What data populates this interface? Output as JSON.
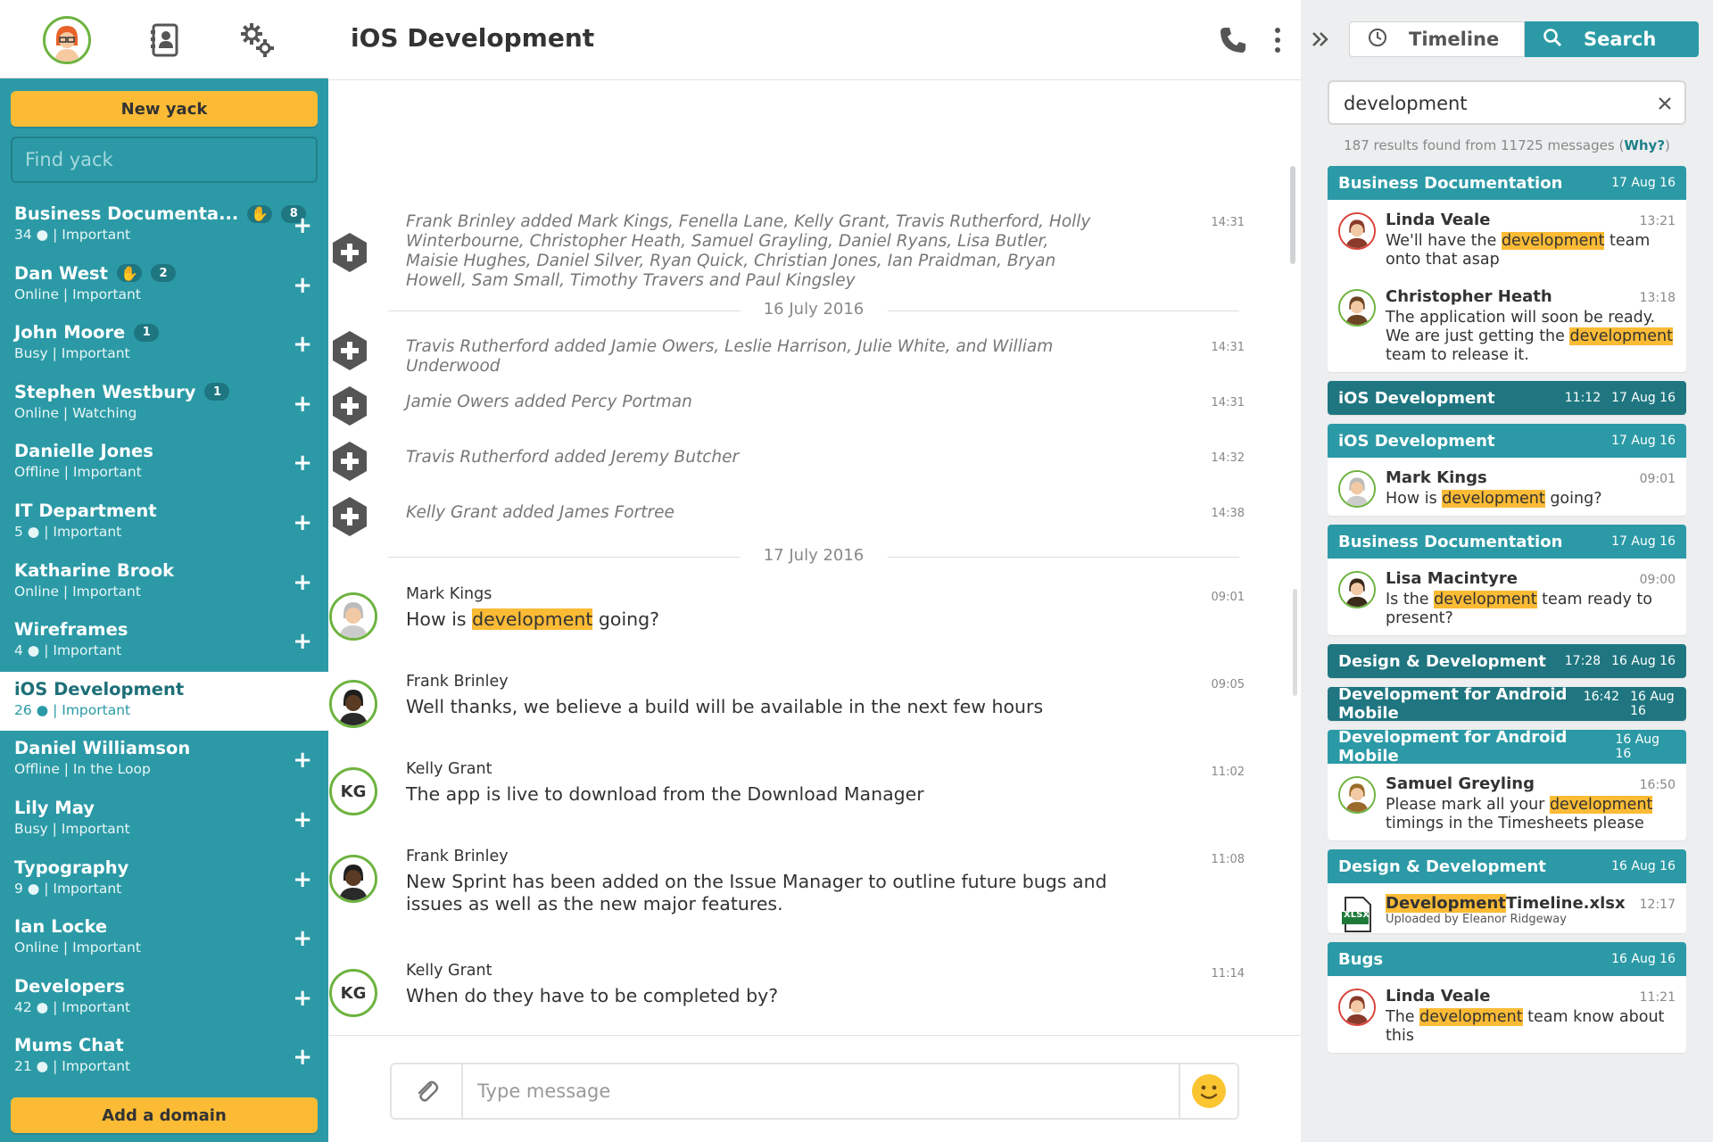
{
  "sidebar": {
    "new_yack_label": "New yack",
    "find_placeholder": "Find yack",
    "add_domain_label": "Add a domain",
    "chats": [
      {
        "name": "Business Documenta...",
        "sub": "34 ● | Important",
        "count": "8",
        "thumb": true
      },
      {
        "name": "Dan West",
        "sub": "Online | Important",
        "count": "2",
        "thumb": true
      },
      {
        "name": "John Moore",
        "sub": "Busy | Important",
        "count": "1"
      },
      {
        "name": "Stephen Westbury",
        "sub": "Online | Watching",
        "count": "1"
      },
      {
        "name": "Danielle Jones",
        "sub": "Offline | Important"
      },
      {
        "name": "IT Department",
        "sub": "5 ● | Important"
      },
      {
        "name": "Katharine Brook",
        "sub": "Online | Important"
      },
      {
        "name": "Wireframes",
        "sub": "4 ● | Important"
      },
      {
        "name": "iOS Development",
        "sub": "26 ● | Important",
        "active": true
      },
      {
        "name": "Daniel Williamson",
        "sub": "Offline | In the Loop"
      },
      {
        "name": "Lily May",
        "sub": "Busy | Important"
      },
      {
        "name": "Typography",
        "sub": "9 ● | Important"
      },
      {
        "name": "Ian Locke",
        "sub": "Online | Important"
      },
      {
        "name": "Developers",
        "sub": "42 ● | Important"
      },
      {
        "name": "Mums Chat",
        "sub": "21 ● | Important"
      }
    ]
  },
  "main": {
    "title": "iOS Development",
    "system_messages": [
      {
        "text": "Frank Brinley added Mark Kings, Fenella Lane, Kelly Grant, Travis Rutherford, Holly Winterbourne, Christopher Heath, Samuel Grayling, Daniel Ryans, Lisa Butler, Maisie Hughes, Daniel Silver, Ryan Quick, Christian Jones, Ian Praidman, Bryan Howell, Sam Small, Timothy Travers and Paul Kingsley",
        "time": "14:31"
      },
      {
        "text": "Travis Rutherford added Jamie Owers, Leslie Harrison, Julie White, and William Underwood",
        "time": "14:31"
      },
      {
        "text": "Jamie Owers added Percy Portman",
        "time": "14:31"
      },
      {
        "text": "Travis Rutherford added Jeremy Butcher",
        "time": "14:32"
      },
      {
        "text": "Kelly Grant added James Fortree",
        "time": "14:38"
      }
    ],
    "date_1": "16 July 2016",
    "date_2": "17 July 2016",
    "messages": [
      {
        "author": "Mark Kings",
        "pre": "How is ",
        "hl": "development",
        "post": " going?",
        "time": "09:01"
      },
      {
        "author": "Frank Brinley",
        "text": "Well thanks, we believe a build will be available in the next few hours",
        "time": "09:05"
      },
      {
        "author": "Kelly Grant",
        "initials": "KG",
        "text": "The app is live to download from the Download Manager",
        "time": "11:02"
      },
      {
        "author": "Frank Brinley",
        "text": "New Sprint has been added on the Issue Manager to outline future bugs and issues as well as the new major features.",
        "time": "11:08"
      },
      {
        "author": "Kelly Grant",
        "initials": "KG",
        "text": "When do they have to be completed by?",
        "time": "11:14"
      }
    ],
    "composer_placeholder": "Type message"
  },
  "right": {
    "tab_timeline": "Timeline",
    "tab_search": "Search",
    "search_value": "development",
    "summary_prefix": "187 results found from 11725 messages (",
    "summary_why": "Why?",
    "summary_suffix": ")",
    "results": [
      {
        "group": "Business Documentation",
        "date": "17 Aug 16",
        "items": [
          {
            "author": "Linda Veale",
            "time": "13:21",
            "pre": "We'll have the ",
            "hl": "development",
            "post": " team onto that asap"
          },
          {
            "author": "Christopher Heath",
            "time": "13:18",
            "pre": "The application will soon be ready. We are just getting the ",
            "hl": "development",
            "post": " team to release it."
          }
        ]
      },
      {
        "group": "iOS Development",
        "time": "11:12",
        "date": "17 Aug 16",
        "collapsed": true
      },
      {
        "group": "iOS Development",
        "date": "17 Aug 16",
        "items": [
          {
            "author": "Mark Kings",
            "time": "09:01",
            "pre": "How is ",
            "hl": "development",
            "post": " going?"
          }
        ]
      },
      {
        "group": "Business Documentation",
        "date": "17 Aug 16",
        "items": [
          {
            "author": "Lisa Macintyre",
            "time": "09:00",
            "pre": "Is the ",
            "hl": "development",
            "post": " team ready to present?"
          }
        ]
      },
      {
        "group": "Design & Development",
        "time": "17:28",
        "date": "16 Aug 16",
        "collapsed": true
      },
      {
        "group": "Development for Android Mobile",
        "time": "16:42",
        "date": "16 Aug 16",
        "collapsed": true
      },
      {
        "group": "Development for Android Mobile",
        "date": "16 Aug 16",
        "items": [
          {
            "author": "Samuel Greyling",
            "time": "16:50",
            "pre": "Please mark all your ",
            "hl": "development",
            "post": " timings in the Timesheets please"
          }
        ]
      },
      {
        "group": "Design & Development",
        "date": "16 Aug 16",
        "items": [
          {
            "file": true,
            "hl": "Development",
            "post": "Timeline.xlsx",
            "time": "12:17",
            "sub": "Uploaded by Eleanor Ridgeway",
            "icon_label": "XLSX"
          }
        ]
      },
      {
        "group": "Bugs",
        "date": "16 Aug 16",
        "items": [
          {
            "author": "Linda Veale",
            "time": "11:21",
            "pre": "The ",
            "hl": "development",
            "post": " team know about this"
          }
        ]
      }
    ]
  },
  "colors": {
    "teal": "#2b9aa6",
    "teal_dark": "#1f7680",
    "yellow": "#fbbb35",
    "green": "#6db33f"
  }
}
